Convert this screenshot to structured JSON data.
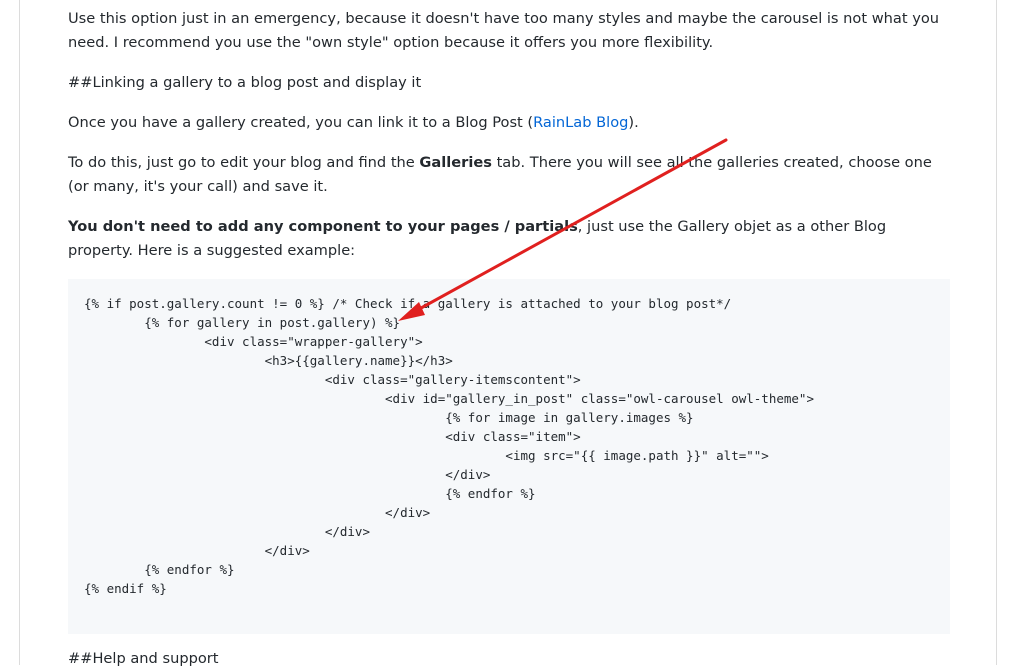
{
  "paragraphs": {
    "emergency": "Use this option just in an emergency, because it doesn't have too many styles and maybe the carousel is not what you need. I recommend you use the \"own style\" option because it offers you more flexibility.",
    "linking_heading": "##Linking a gallery to a blog post and display it",
    "created_prefix": "Once you have a gallery created, you can link it to a Blog Post (",
    "rainlab_link": "RainLab Blog",
    "created_suffix": ").",
    "todo_prefix": "To do this, just go to edit your blog and find the ",
    "galleries_bold": "Galleries",
    "todo_suffix": " tab. There you will see all the galleries created, choose one (or many, it's your call) and save it.",
    "component_bold": "You don't need to add any component to your pages / partials",
    "component_suffix": ", just use the Gallery objet as a other Blog property. Here is a suggested example:",
    "help_heading": "##Help and support"
  },
  "code": {
    "lines": [
      "{% if post.gallery.count != 0 %} /* Check if a gallery is attached to your blog post*/",
      "        {% for gallery in post.gallery) %}",
      "                <div class=\"wrapper-gallery\">",
      "                        <h3>{{gallery.name}}</h3>",
      "                                <div class=\"gallery-itemscontent\">",
      "                                        <div id=\"gallery_in_post\" class=\"owl-carousel owl-theme\">",
      "                                                {% for image in gallery.images %}",
      "                                                <div class=\"item\">",
      "                                                        <img src=\"{{ image.path }}\" alt=\"\">",
      "                                                </div>",
      "                                                {% endfor %}",
      "                                        </div>",
      "                                </div>",
      "                        </div>",
      "        {% endfor %}",
      "{% endif %}"
    ]
  },
  "colors": {
    "link": "#0366d6",
    "code_bg": "#f6f8fa",
    "annotation_arrow": "#e0201f"
  }
}
